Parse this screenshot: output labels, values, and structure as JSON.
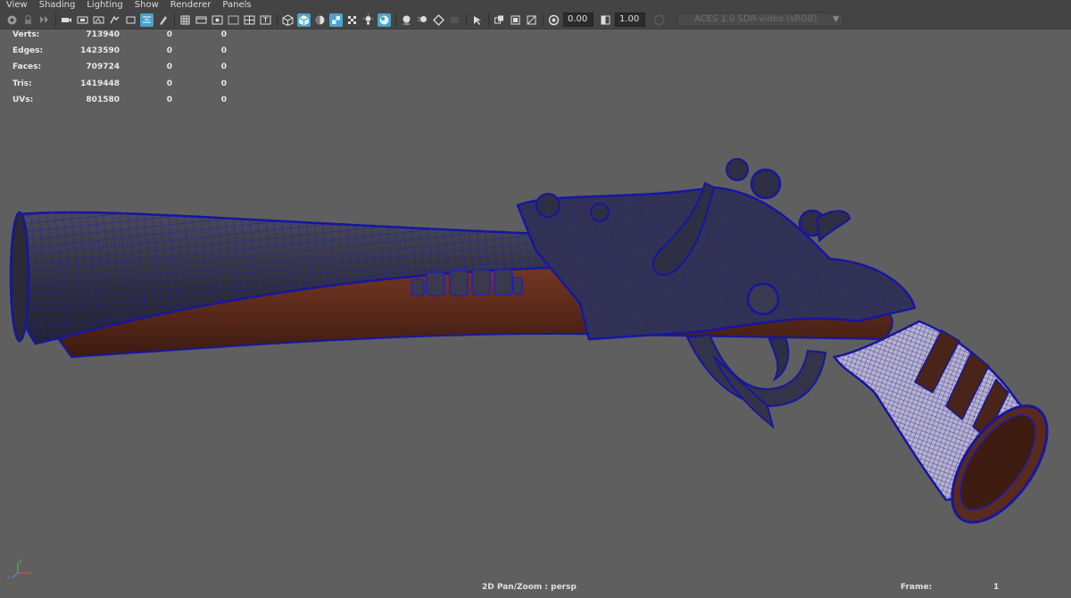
{
  "menu": [
    "View",
    "Shading",
    "Lighting",
    "Show",
    "Renderer",
    "Panels"
  ],
  "toolbar": {
    "icons": [
      "camera-select-icon",
      "lock-camera-icon",
      "bookmark-icon",
      "image-plane-icon",
      "grid-icon",
      "film-gate-icon",
      "resolution-gate-icon",
      "gate-mask-icon",
      "field-chart-icon",
      "safe-title-icon",
      "wireframe-icon",
      "smooth-shade-icon",
      "bounding-box-icon",
      "textured-icon",
      "lights-icon",
      "shadows-icon",
      "ambient-occlusion-icon",
      "motion-blur-icon",
      "anti-alias-icon",
      "depth-of-field-icon",
      "isolate-select-icon",
      "xray-icon",
      "xray-joints-icon",
      "backface-icon",
      "exposure-icon",
      "gamma-icon"
    ],
    "exposure_value": "0.00",
    "gamma_value": "1.00",
    "color_space": "ACES 1.0 SDR-video (sRGB)",
    "accent": "#4aa3c9"
  },
  "stats": [
    {
      "label": "Verts:",
      "v1": "713940",
      "v2": "0",
      "v3": "0"
    },
    {
      "label": "Edges:",
      "v1": "1423590",
      "v2": "0",
      "v3": "0"
    },
    {
      "label": "Faces:",
      "v1": "709724",
      "v2": "0",
      "v3": "0"
    },
    {
      "label": "Tris:",
      "v1": "1419448",
      "v2": "0",
      "v3": "0"
    },
    {
      "label": "UVs:",
      "v1": "801580",
      "v2": "0",
      "v3": "0"
    }
  ],
  "hud": {
    "camera": "2D Pan/Zoom : persp",
    "frame_label": "Frame:",
    "frame_value": "1"
  },
  "axis": {
    "x": "x",
    "y": "y",
    "z": "z"
  },
  "colors": {
    "viewport_bg": "#5f5f5f",
    "wire": "#1a1aa8",
    "wood": "#6a2f1f",
    "metal": "#3a3a4a",
    "ivory": "#b8b2c8"
  }
}
